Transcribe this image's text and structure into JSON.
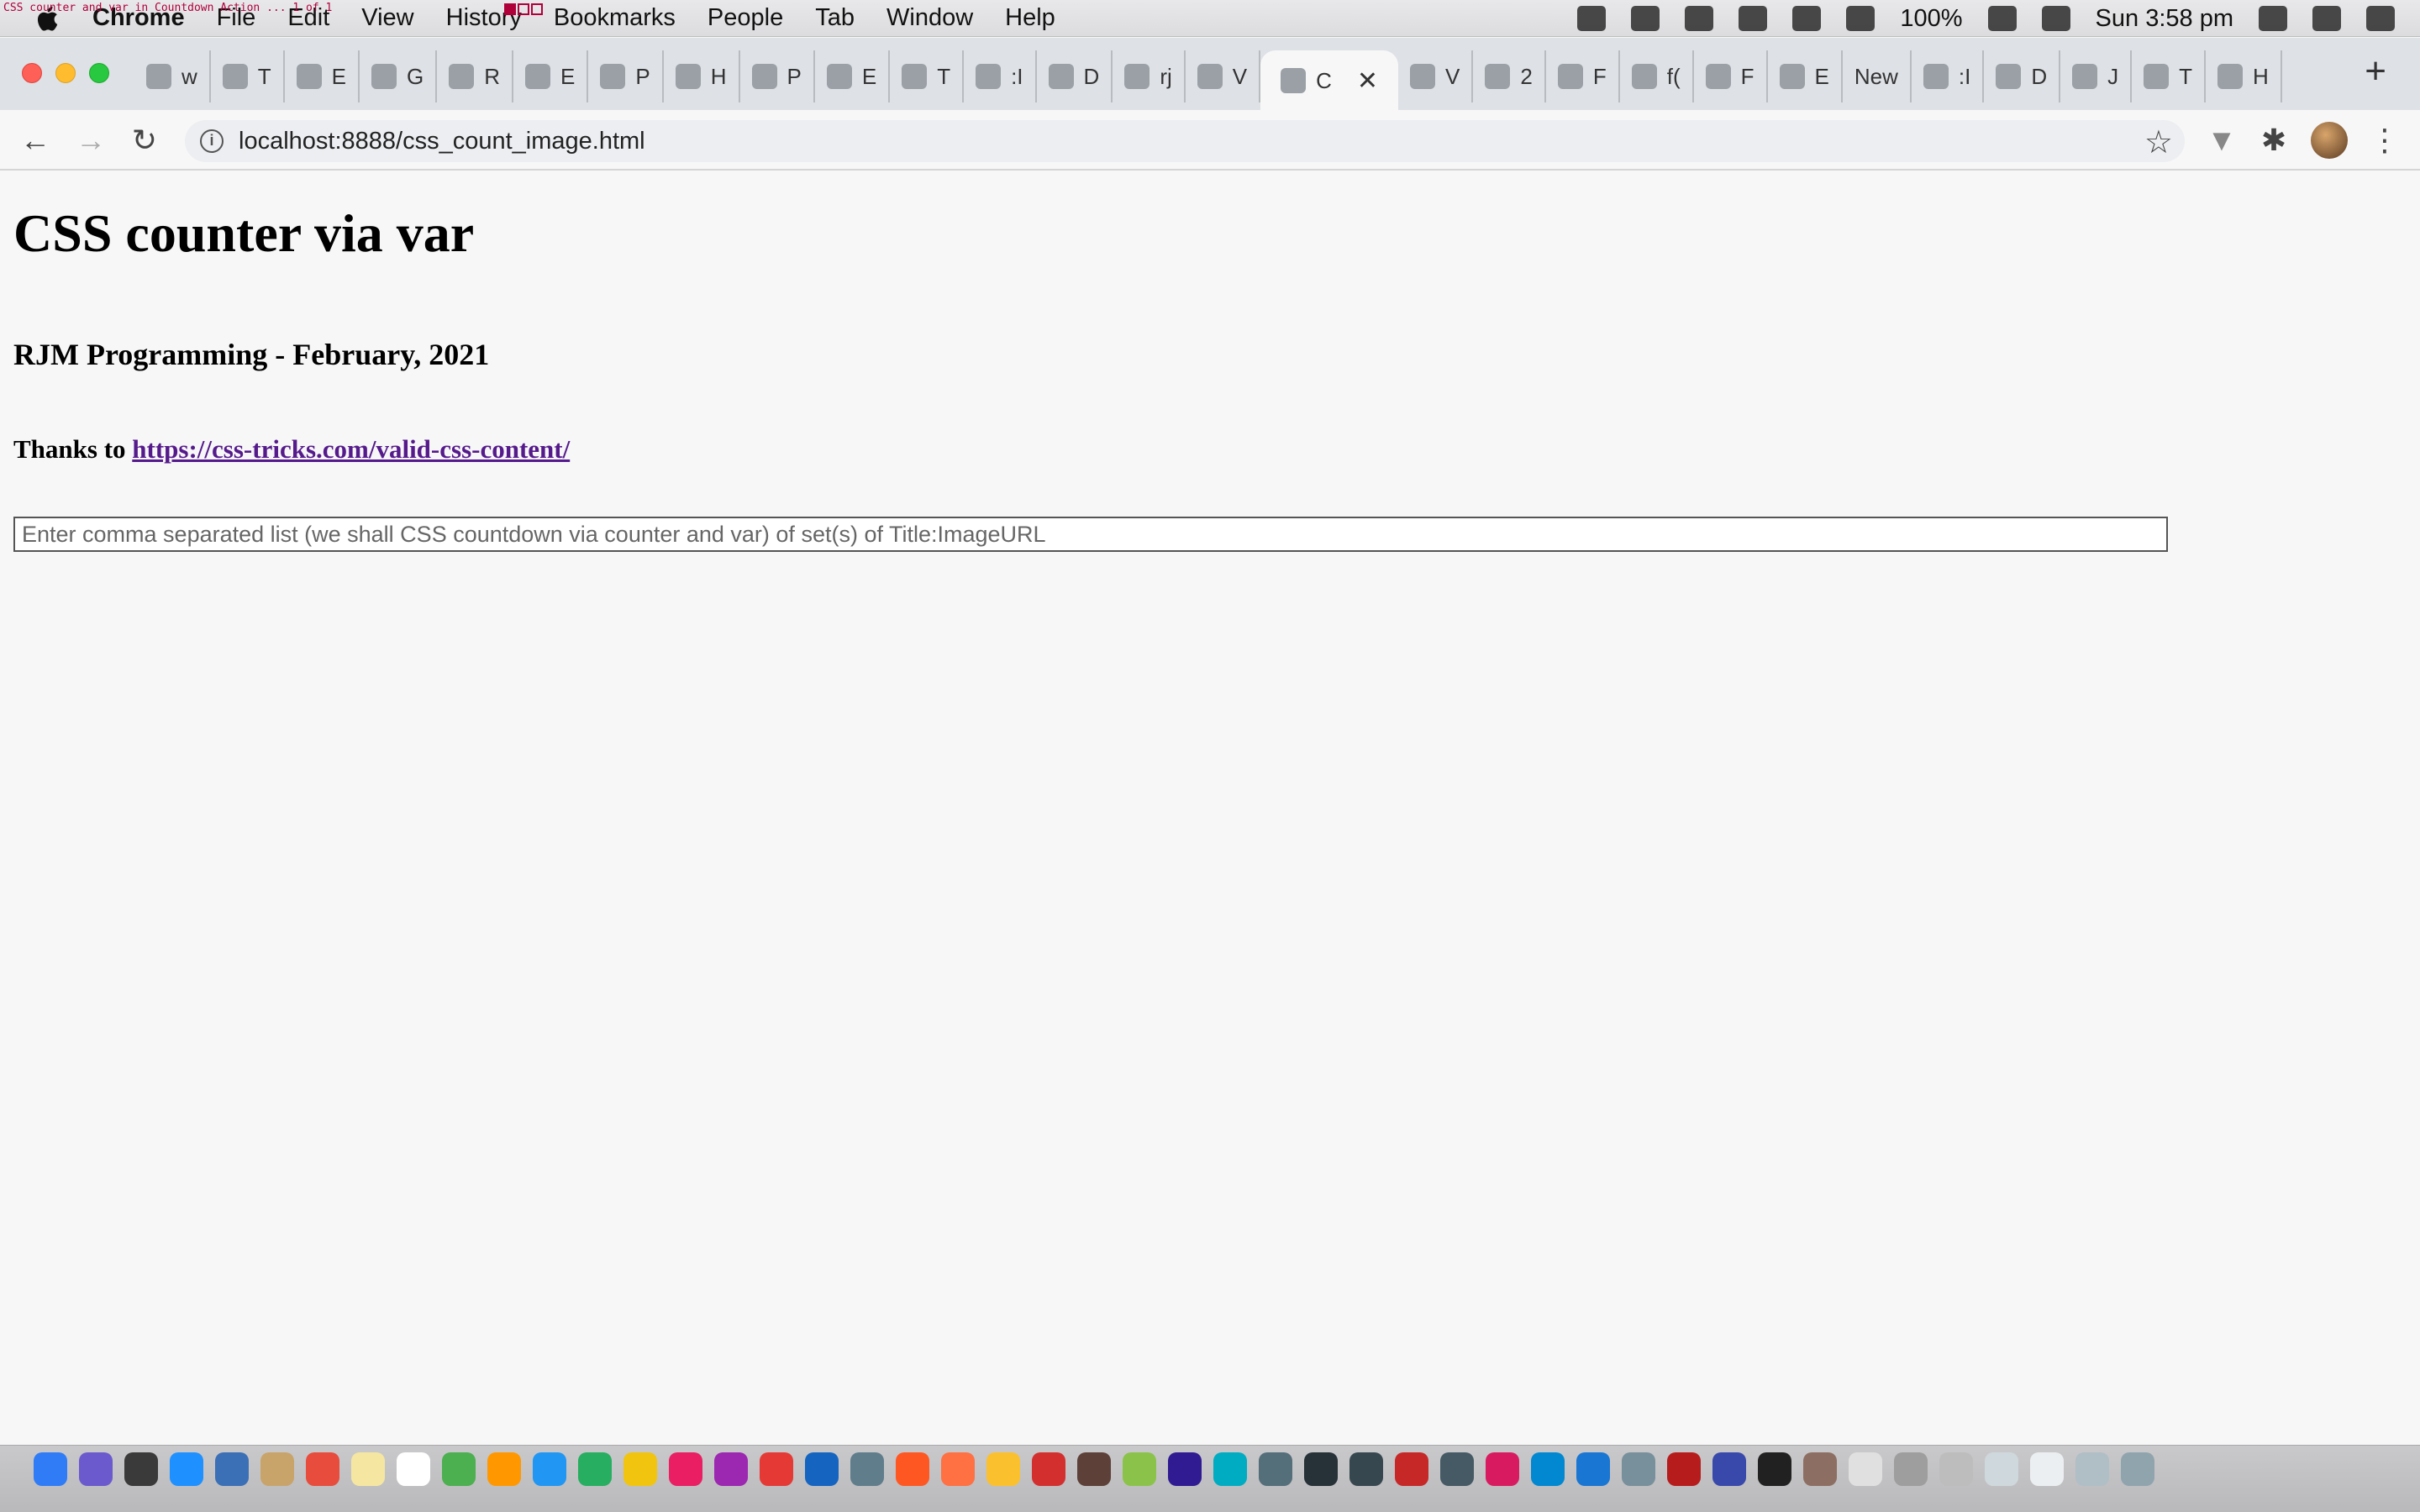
{
  "overlay": {
    "caption": "CSS counter and var in Countdown Action ... 1 of 1"
  },
  "menubar": {
    "app_name": "Chrome",
    "items": [
      "File",
      "Edit",
      "View",
      "History",
      "Bookmarks",
      "People",
      "Tab",
      "Window",
      "Help"
    ],
    "battery": "100%",
    "clock": "Sun 3:58 pm"
  },
  "tabs": [
    {
      "label": "w"
    },
    {
      "label": "T"
    },
    {
      "label": "E"
    },
    {
      "label": "G"
    },
    {
      "label": "R"
    },
    {
      "label": "E"
    },
    {
      "label": "P"
    },
    {
      "label": "H"
    },
    {
      "label": "P"
    },
    {
      "label": "E"
    },
    {
      "label": "T"
    },
    {
      "label": ":I"
    },
    {
      "label": "D"
    },
    {
      "label": "rj"
    },
    {
      "label": "V"
    },
    {
      "label": "C",
      "active": true
    },
    {
      "label": "V"
    },
    {
      "label": "2"
    },
    {
      "label": "F"
    },
    {
      "label": "f("
    },
    {
      "label": "F"
    },
    {
      "label": "E"
    },
    {
      "label": "New"
    },
    {
      "label": ":I"
    },
    {
      "label": "D"
    },
    {
      "label": "J"
    },
    {
      "label": "T"
    },
    {
      "label": "H"
    }
  ],
  "toolbar": {
    "url": "localhost:8888/css_count_image.html"
  },
  "page": {
    "title": "CSS counter via var",
    "subtitle": "RJM Programming - February, 2021",
    "thanks_prefix": "Thanks to ",
    "thanks_link": "https://css-tricks.com/valid-css-content/",
    "input_placeholder": "Enter comma separated list (we shall CSS countdown via counter and var) of set(s) of Title:ImageURL"
  },
  "icons": {
    "tray": [
      "gpu-icon",
      "malwarebytes-icon",
      "airplay-icon",
      "bluetooth-icon",
      "wifi-icon",
      "volume-icon",
      "battery-icon",
      "calendar-icon",
      "spotlight-icon",
      "siri-icon",
      "control-center-icon"
    ]
  }
}
